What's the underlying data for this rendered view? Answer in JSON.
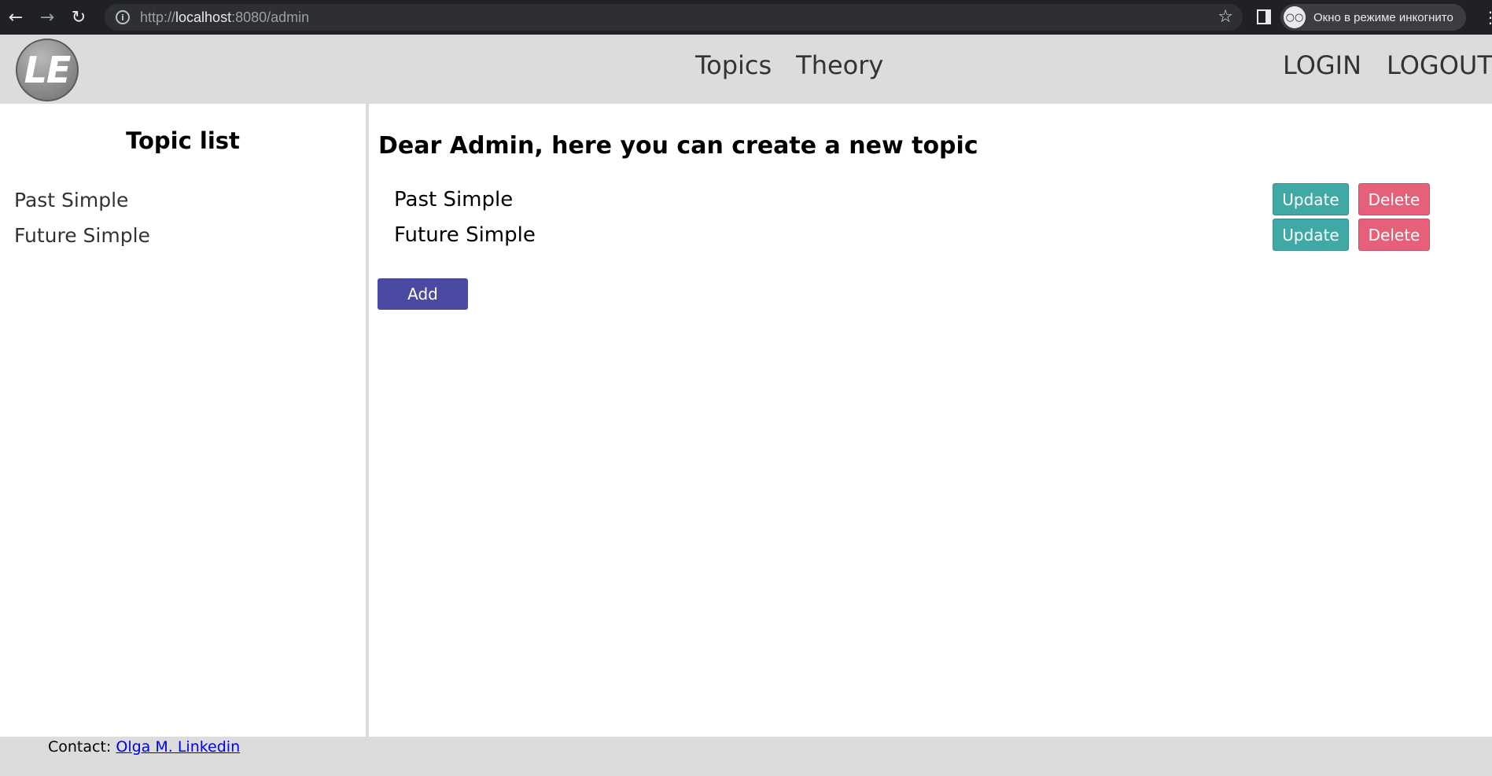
{
  "browser": {
    "url_scheme": "http://",
    "url_host": "localhost",
    "url_rest": ":8080/admin",
    "incognito_label": "Окно в режиме инкогнито",
    "icons": [
      "back-arrow-icon",
      "forward-arrow-icon",
      "reload-icon",
      "info-icon",
      "star-icon",
      "side-panel-icon",
      "incognito-icon",
      "kebab-menu-icon"
    ]
  },
  "header": {
    "logo_text": "LE",
    "nav": {
      "topics": "Topics",
      "theory": "Theory"
    },
    "auth": {
      "login": "LOGIN",
      "logout": "LOGOUT"
    },
    "background": "#dcdcdc"
  },
  "sidebar": {
    "title": "Topic list",
    "items": [
      {
        "label": "Past Simple"
      },
      {
        "label": "Future Simple"
      }
    ]
  },
  "main": {
    "heading": "Dear Admin, here you can create a new topic",
    "topics": [
      {
        "name": "Past Simple",
        "update_label": "Update",
        "delete_label": "Delete"
      },
      {
        "name": "Future Simple",
        "update_label": "Update",
        "delete_label": "Delete"
      }
    ],
    "add_label": "Add",
    "colors": {
      "update": "#40a9a6",
      "delete": "#e66079",
      "add": "#4b4aa3"
    }
  },
  "footer": {
    "contact_label": "Contact:",
    "contact_link": "Olga M. Linkedin"
  }
}
